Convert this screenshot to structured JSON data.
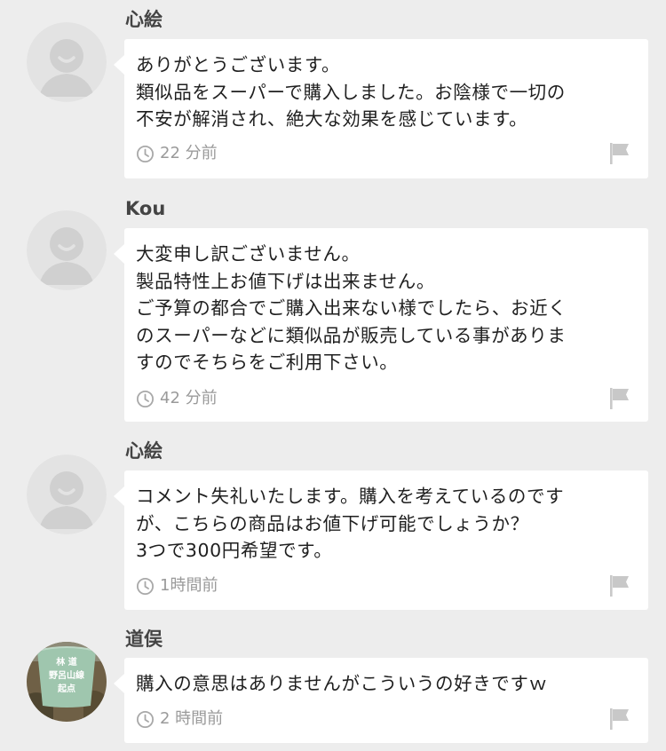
{
  "comments": [
    {
      "user": "心絵",
      "avatar": "default-avatar",
      "message": "ありがとうございます。\n類似品をスーパーで購入しました。お陰様で一切の\n不安が解消され、絶大な効果を感じています。",
      "time": "22 分前"
    },
    {
      "user": "Kou",
      "avatar": "default-avatar",
      "message": "大変申し訳ございません。\n製品特性上お値下げは出来ません。\nご予算の都合でご購入出来ない様でしたら、お近く\nのスーパーなどに類似品が販売している事がありま\nすのでそちらをご利用下さい。",
      "time": "42 分前"
    },
    {
      "user": "心絵",
      "avatar": "default-avatar",
      "message": "コメント失礼いたします。購入を考えているのです\nが、こちらの商品はお値下げ可能でしょうか？\n3つで300円希望です。",
      "time": "1時間前"
    },
    {
      "user": "道俣",
      "avatar": "photo-avatar",
      "avatar_sign_text": "林 道\n野呂山線\n起点",
      "message": "購入の意思はありませんがこういうの好きですｗ",
      "time": "2 時間前"
    }
  ],
  "icons": {
    "time": "clock-icon",
    "report": "flag-icon",
    "default_avatar": "person-silhouette-icon"
  },
  "colors": {
    "background": "#ededed",
    "bubble": "#ffffff",
    "muted_text": "#9a9a9a",
    "avatar_bg": "#e3e3e3",
    "avatar_fg": "#cfcfcf"
  }
}
